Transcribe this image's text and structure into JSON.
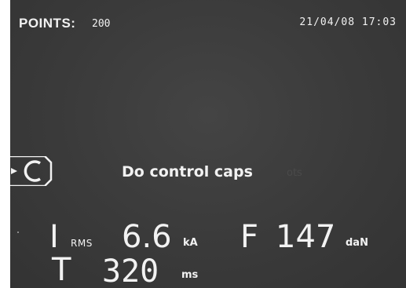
{
  "header": {
    "points_label": "POINTS",
    "points_separator": ":",
    "points_value": "200",
    "datetime": "21/04/08 17:03"
  },
  "status": {
    "caps_icon": "caps-c-icon",
    "message": "Do control caps",
    "ghost_text": "ots"
  },
  "readings": {
    "current": {
      "symbol": "I",
      "subscript": "RMS",
      "value": "6.6",
      "unit": "kA"
    },
    "force": {
      "symbol": "F",
      "value": "147",
      "unit": "daN"
    },
    "time": {
      "symbol": "T",
      "value": "320",
      "unit": "ms"
    }
  },
  "colors": {
    "background": "#3a3a3a",
    "text": "#f2f2f2",
    "ghost": "#4a4a4a"
  }
}
